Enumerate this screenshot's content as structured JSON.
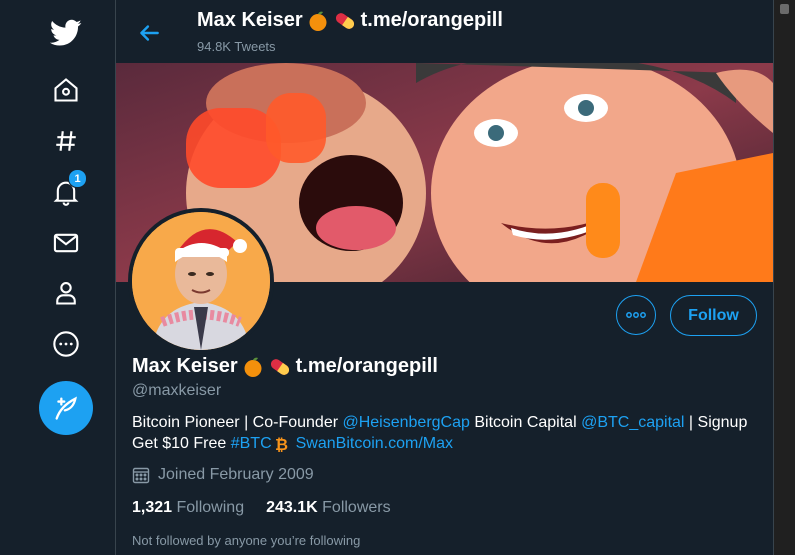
{
  "colors": {
    "background": "#15202b",
    "accent": "#1da1f2",
    "muted": "#8899a6"
  },
  "nav": {
    "items": [
      {
        "icon": "twitter-bird-icon"
      },
      {
        "icon": "home-icon"
      },
      {
        "icon": "hashtag-icon"
      },
      {
        "icon": "bell-icon",
        "badge": "1"
      },
      {
        "icon": "mail-icon"
      },
      {
        "icon": "profile-icon"
      },
      {
        "icon": "more-circle-icon"
      },
      {
        "icon": "compose-tweet-icon"
      }
    ]
  },
  "header": {
    "name": "Max Keiser",
    "name_suffix": "t.me/orangepill",
    "tweet_count": "94.8K Tweets"
  },
  "profile": {
    "name": "Max Keiser",
    "name_suffix": "t.me/orangepill",
    "handle": "@maxkeiser",
    "follow_label": "Follow",
    "bio": {
      "t1": "Bitcoin Pioneer | Co-Founder ",
      "mention1": "@HeisenbergCap",
      "t2": " Bitcoin Capital ",
      "mention2": "@BTC_capital",
      "t3": " | Signup Get $10 Free ",
      "hashtag": "#BTC",
      "link": "SwanBitcoin.com/Max"
    },
    "joined": "Joined February 2009",
    "following_count": "1,321",
    "following_label": "Following",
    "followers_count": "243.1K",
    "followers_label": "Followers",
    "not_followed": "Not followed by anyone you’re following"
  }
}
